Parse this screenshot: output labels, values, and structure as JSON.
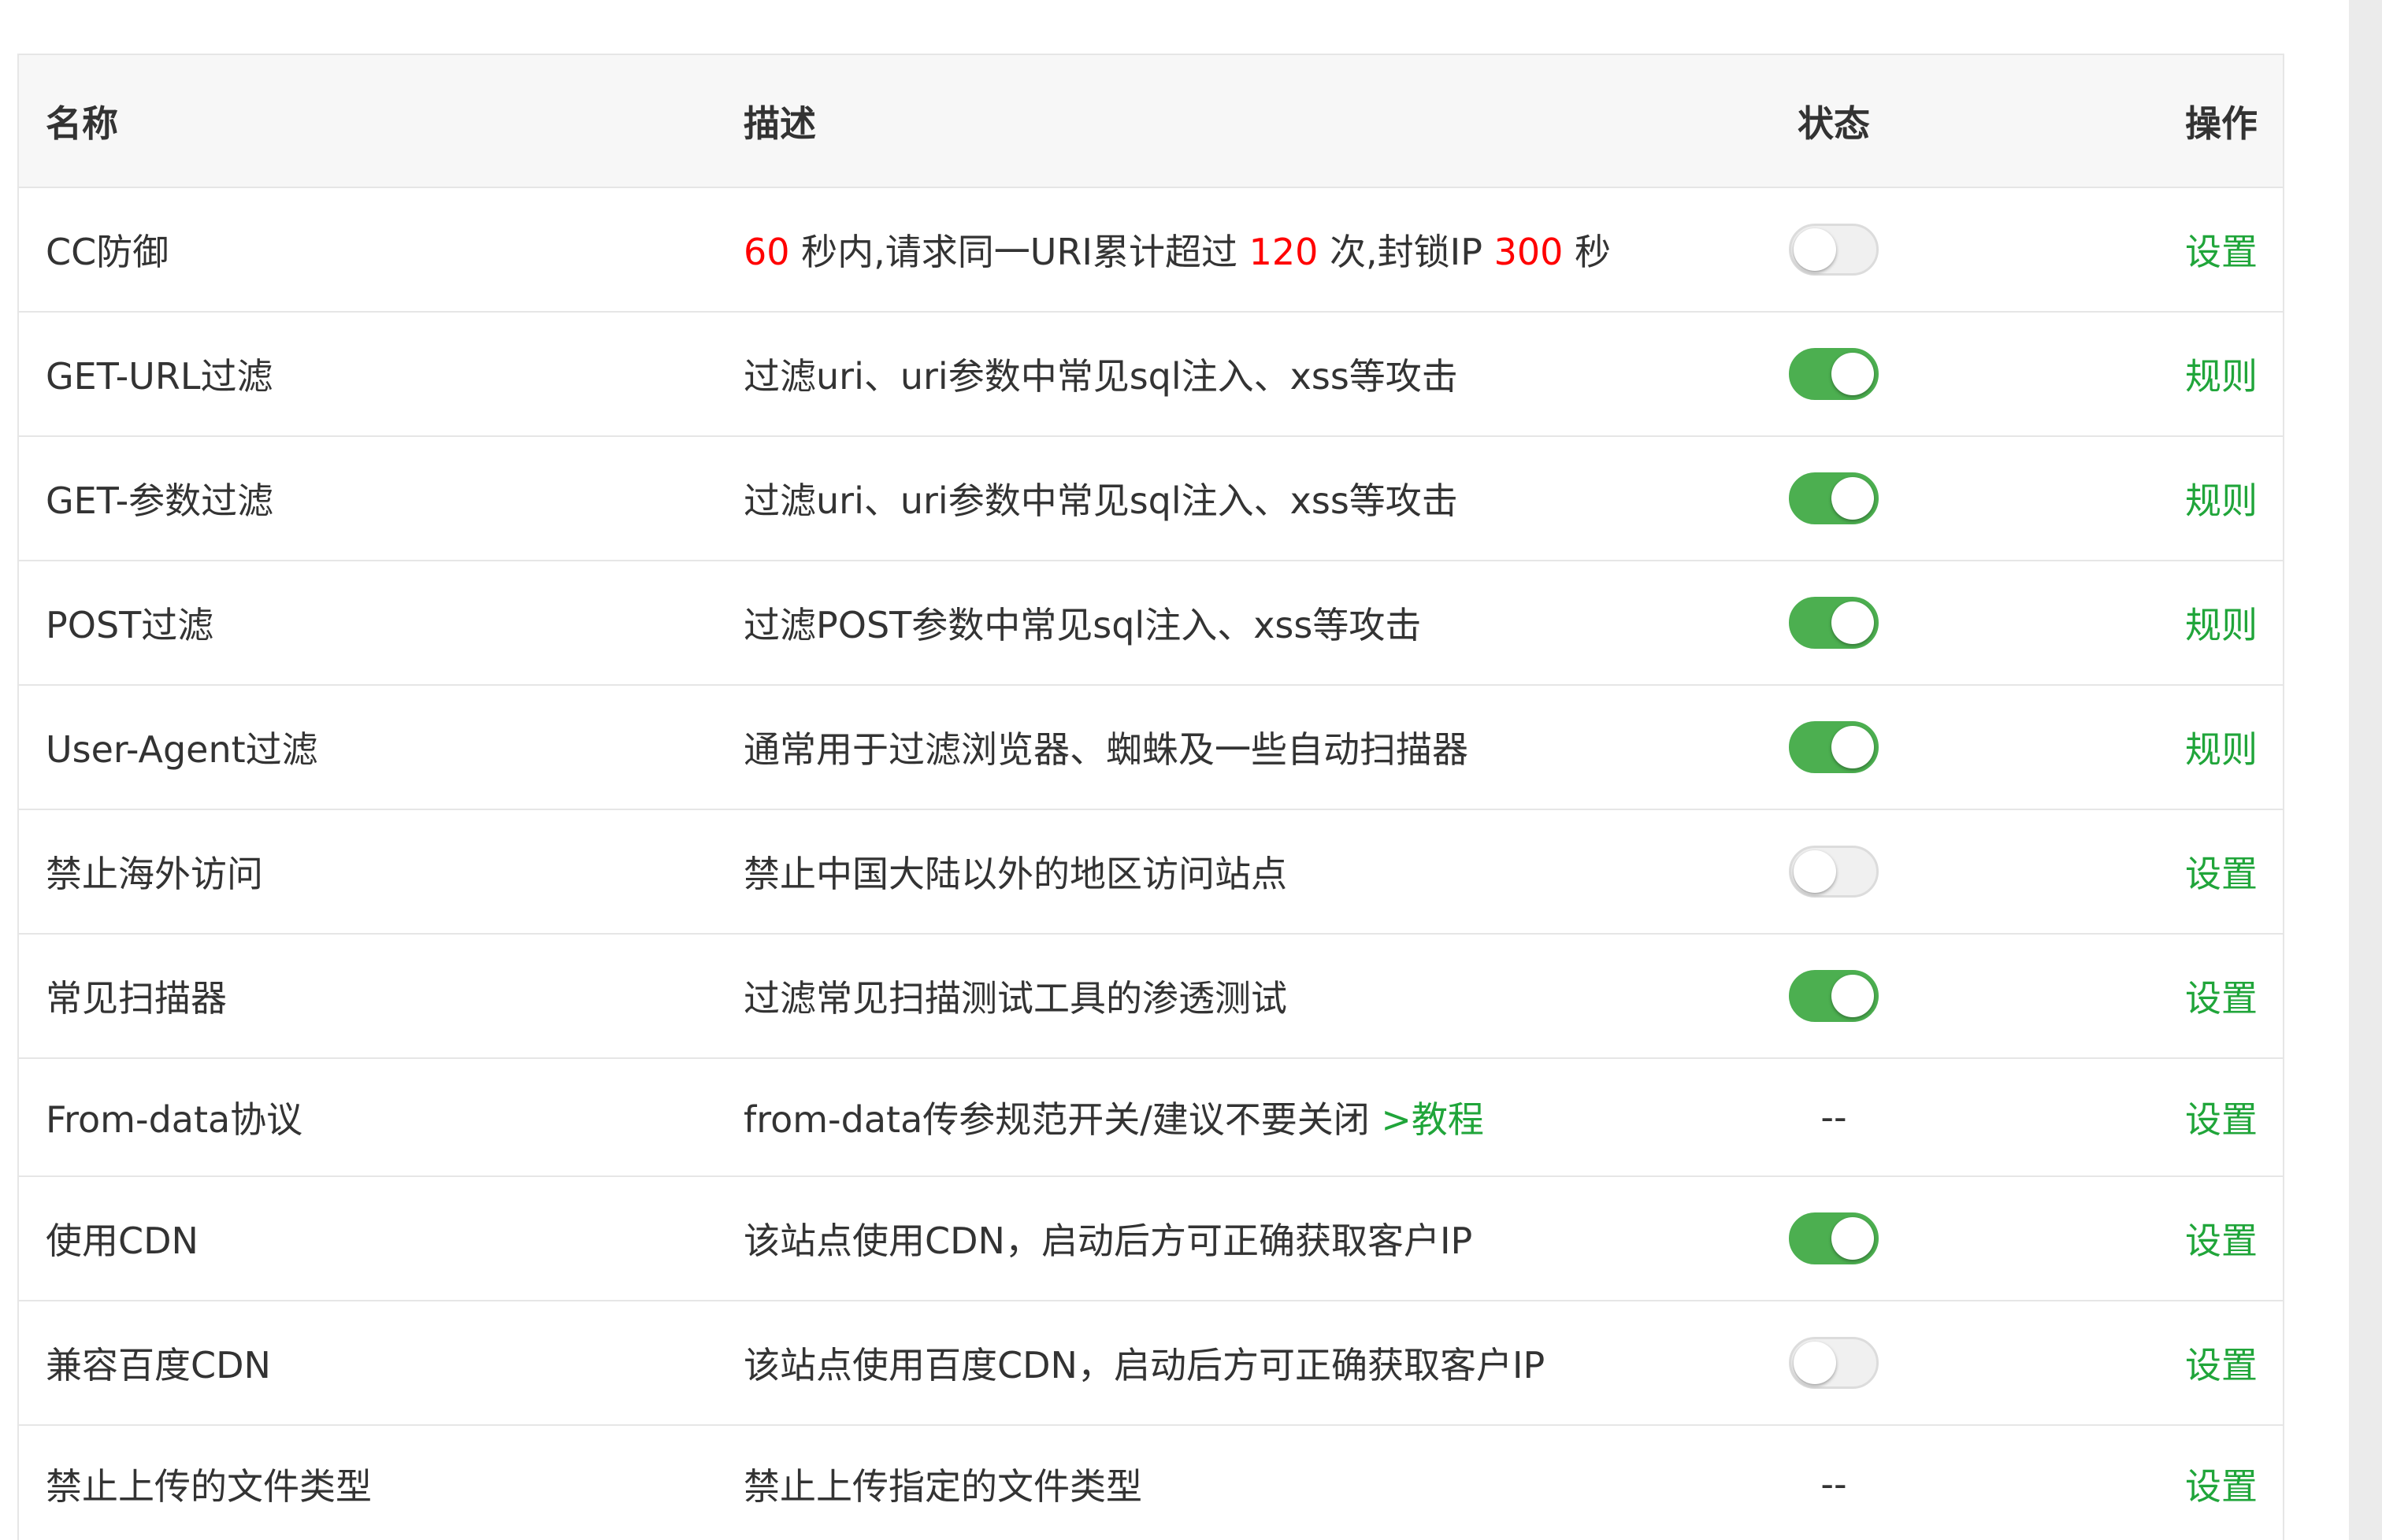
{
  "header": {
    "name": "名称",
    "description": "描述",
    "status": "状态",
    "action": "操作"
  },
  "rows": [
    {
      "name": "CC防御",
      "desc_parts": {
        "v1": "60",
        "t1": " 秒内,请求同一URI累计超过 ",
        "v2": "120",
        "t2": " 次,封锁IP ",
        "v3": "300",
        "t3": " 秒"
      },
      "status": "off",
      "action": "设置"
    },
    {
      "name": "GET-URL过滤",
      "description": "过滤uri、uri参数中常见sql注入、xss等攻击",
      "status": "on",
      "action": "规则"
    },
    {
      "name": "GET-参数过滤",
      "description": "过滤uri、uri参数中常见sql注入、xss等攻击",
      "status": "on",
      "action": "规则"
    },
    {
      "name": "POST过滤",
      "description": "过滤POST参数中常见sql注入、xss等攻击",
      "status": "on",
      "action": "规则"
    },
    {
      "name": "User-Agent过滤",
      "description": "通常用于过滤浏览器、蜘蛛及一些自动扫描器",
      "status": "on",
      "action": "规则"
    },
    {
      "name": "禁止海外访问",
      "description": "禁止中国大陆以外的地区访问站点",
      "status": "off",
      "action": "设置"
    },
    {
      "name": "常见扫描器",
      "description": "过滤常见扫描测试工具的渗透测试",
      "status": "on",
      "action": "设置"
    },
    {
      "name": "From-data协议",
      "description": "from-data传参规范开关/建议不要关闭 ",
      "link": ">教程",
      "status_text": "--",
      "action": "设置"
    },
    {
      "name": "使用CDN",
      "description": "该站点使用CDN，启动后方可正确获取客户IP",
      "status": "on",
      "action": "设置"
    },
    {
      "name": "兼容百度CDN",
      "description": "该站点使用百度CDN，启动后方可正确获取客户IP",
      "status": "off",
      "action": "设置"
    },
    {
      "name": "禁止上传的文件类型",
      "description": "禁止上传指定的文件类型",
      "status_text": "--",
      "action": "设置"
    }
  ],
  "colors": {
    "accent_green": "#20a53a",
    "toggle_on": "#4caf50",
    "highlight_red": "#ff0000"
  }
}
